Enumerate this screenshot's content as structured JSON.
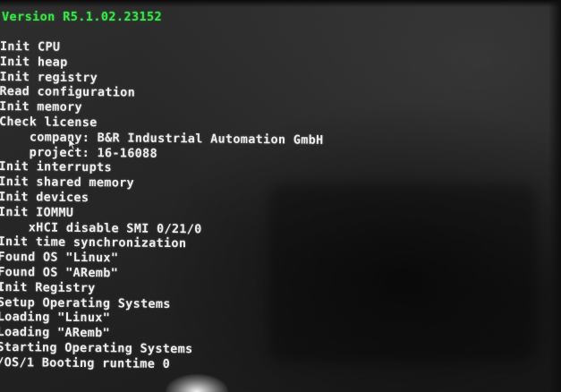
{
  "version_line": "Version R5.1.02.23152",
  "colors": {
    "version_text": "#38e64a",
    "log_text": "#eeeeee",
    "background": "#262626"
  },
  "log_lines": [
    {
      "text": "Init CPU",
      "indent": false
    },
    {
      "text": "Init heap",
      "indent": false
    },
    {
      "text": "Init registry",
      "indent": false
    },
    {
      "text": "Read configuration",
      "indent": false
    },
    {
      "text": "Init memory",
      "indent": false
    },
    {
      "text": "Check license",
      "indent": false
    },
    {
      "text": "company: B&R Industrial Automation GmbH",
      "indent": true
    },
    {
      "text": "project: 16-16088",
      "indent": true
    },
    {
      "text": "Init interrupts",
      "indent": false
    },
    {
      "text": "Init shared memory",
      "indent": false
    },
    {
      "text": "Init devices",
      "indent": false
    },
    {
      "text": "Init IOMMU",
      "indent": false
    },
    {
      "text": "xHCI disable SMI 0/21/0",
      "indent": true
    },
    {
      "text": "Init time synchronization",
      "indent": false
    },
    {
      "text": "Found OS \"Linux\"",
      "indent": false
    },
    {
      "text": "Found OS \"ARemb\"",
      "indent": false
    },
    {
      "text": "Init Registry",
      "indent": false
    },
    {
      "text": "Setup Operating Systems",
      "indent": false
    },
    {
      "text": "Loading \"Linux\"",
      "indent": false
    },
    {
      "text": "Loading \"ARemb\"",
      "indent": false
    },
    {
      "text": "Starting Operating Systems",
      "indent": false
    },
    {
      "text": "/OS/1 Booting runtime 0",
      "indent": false
    }
  ]
}
